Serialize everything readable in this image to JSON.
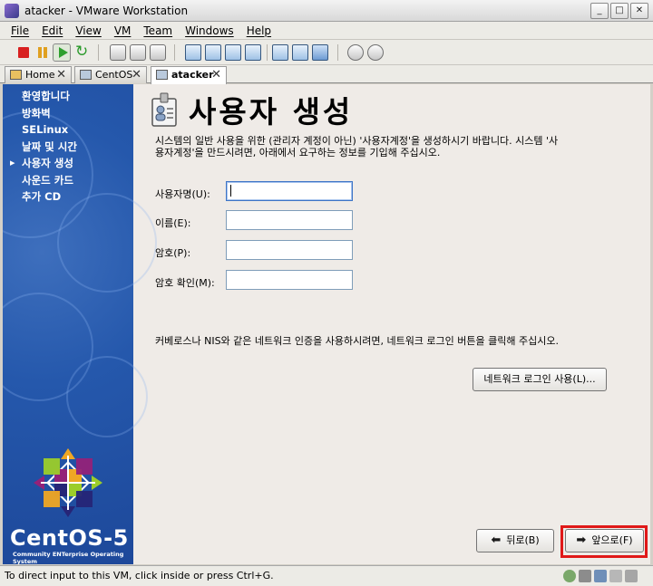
{
  "window": {
    "title": "atacker - VMware Workstation",
    "min": "_",
    "max": "□",
    "close": "✕"
  },
  "menu": [
    "File",
    "Edit",
    "View",
    "VM",
    "Team",
    "Windows",
    "Help"
  ],
  "tabs": [
    {
      "label": "Home",
      "close": "✕"
    },
    {
      "label": "CentOS",
      "close": "✕"
    },
    {
      "label": "atacker",
      "close": "✕"
    }
  ],
  "sidebar": {
    "items": [
      "환영합니다",
      "방화벽",
      "SELinux",
      "날짜 및 시간",
      "사용자 생성",
      "사운드 카드",
      "추가 CD"
    ],
    "current_index": 4,
    "brand": "CentOS-5",
    "brand_sub": "Community ENTerprise Operating System"
  },
  "page": {
    "title": "사용자 생성",
    "intro": "시스템의 일반 사용을 위한 (관리자 계정이 아닌) '사용자계정'을 생성하시기 바랍니다. 시스템 '사용자계정'을 만드시려면, 아래에서 요구하는 정보를 기입해 주십시오.",
    "fields": {
      "username": {
        "label": "사용자명(U):",
        "value": ""
      },
      "fullname": {
        "label": "이름(E):",
        "value": ""
      },
      "password": {
        "label": "암호(P):",
        "value": ""
      },
      "confirm": {
        "label": "암호 확인(M):",
        "value": ""
      }
    },
    "network_note": "커베로스나 NIS와 같은 네트워크 인증을 사용하시려면, 네트워크 로그인 버튼을 클릭해 주십시오.",
    "network_login_button": "네트워크 로그인 사용(L)...",
    "back_button": "뒤로(B)",
    "next_button": "앞으로(F)"
  },
  "status": {
    "text": "To direct input to this VM, click inside or press Ctrl+G."
  },
  "colors": {
    "sidebar": "#2558ac",
    "highlight": "#e01818"
  }
}
